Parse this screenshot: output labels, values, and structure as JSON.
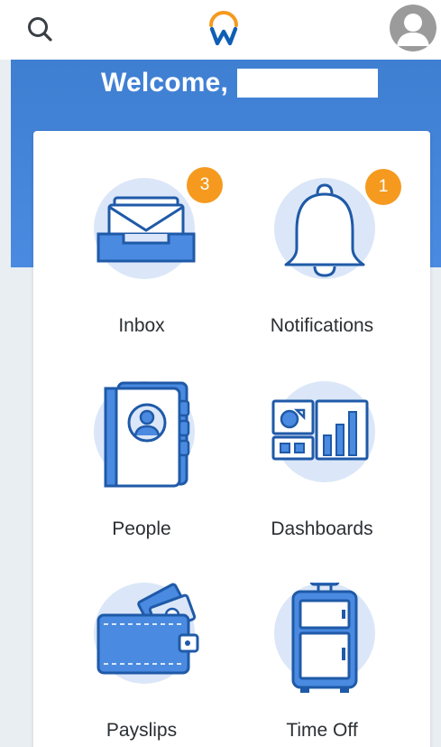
{
  "header": {
    "welcome_text": "Welcome,"
  },
  "tiles": [
    {
      "label": "Inbox",
      "badge": "3"
    },
    {
      "label": "Notifications",
      "badge": "1"
    },
    {
      "label": "People"
    },
    {
      "label": "Dashboards"
    },
    {
      "label": "Payslips"
    },
    {
      "label": "Time Off"
    }
  ],
  "colors": {
    "brand_blue": "#3f7fd2",
    "badge_orange": "#f59a1f",
    "icon_circle": "#dbe7f8"
  },
  "icons": {
    "search": "search-icon",
    "logo": "workday-logo",
    "avatar": "user-avatar-icon"
  }
}
